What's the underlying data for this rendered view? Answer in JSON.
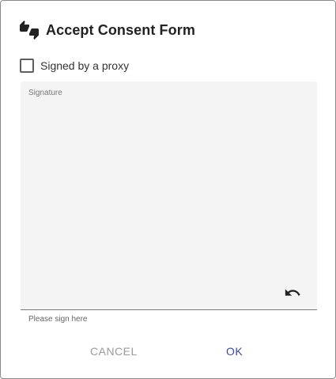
{
  "dialog": {
    "title": "Accept Consent Form",
    "title_icon": "thumbs-up-down-icon"
  },
  "proxy": {
    "label": "Signed by a proxy",
    "checked": false
  },
  "signature": {
    "label": "Signature",
    "helper": "Please sign here",
    "undo_icon": "undo-icon"
  },
  "actions": {
    "cancel_label": "CANCEL",
    "ok_label": "OK"
  },
  "colors": {
    "accent": "#3c4a9a",
    "cancel_text": "#9a9a9a",
    "signature_bg": "#f4f4f4"
  }
}
